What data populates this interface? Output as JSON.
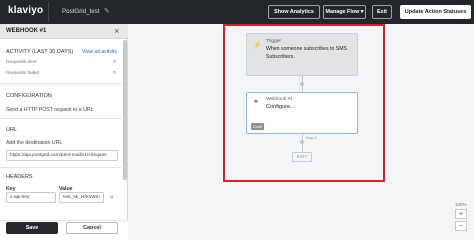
{
  "topbar": {
    "logo": "klaviyo",
    "flow_name": "PostGrid_test",
    "show_analytics": "Show Analytics",
    "manage_flow": "Manage Flow ▾",
    "exit": "Exit",
    "update_action_statuses": "Update Action Statuses"
  },
  "panel": {
    "title": "WEBHOOK #1",
    "close": "×",
    "activity": {
      "heading": "ACTIVITY (LAST 30 DAYS)",
      "view_all": "View all activity",
      "rows": [
        {
          "label": "Requests sent",
          "value": "0"
        },
        {
          "label": "Requests failed",
          "value": "0"
        }
      ]
    },
    "configuration": {
      "heading": "CONFIGURATION",
      "description": "Send a HTTP POST request to a URL"
    },
    "url": {
      "heading": "URL",
      "description": "Add the destination URL",
      "value": "https://api.postgrid.com/print-mail/v1/cheques"
    },
    "headers": {
      "heading": "HEADERS",
      "key_label": "Key",
      "value_label": "Value",
      "key_value": "x-api-key",
      "value_value": "test_sk_NfKsWm",
      "remove": "×"
    },
    "save": "Save",
    "cancel": "Cancel"
  },
  "canvas": {
    "trigger": {
      "label": "Trigger",
      "description": "When someone subscribes to SMS Subscribers."
    },
    "webhook": {
      "label": "Webhook #1",
      "description": "Configure...",
      "badge": "Draft"
    },
    "day_label": "Day 0",
    "exit": "EXIT",
    "zoom": {
      "level": "100%",
      "plus": "+",
      "minus": "−"
    }
  },
  "colors": {
    "topbar": "#23272b",
    "highlight": "#e31b23",
    "link": "#1d6fd8",
    "selected_border": "#8ab4f8"
  }
}
